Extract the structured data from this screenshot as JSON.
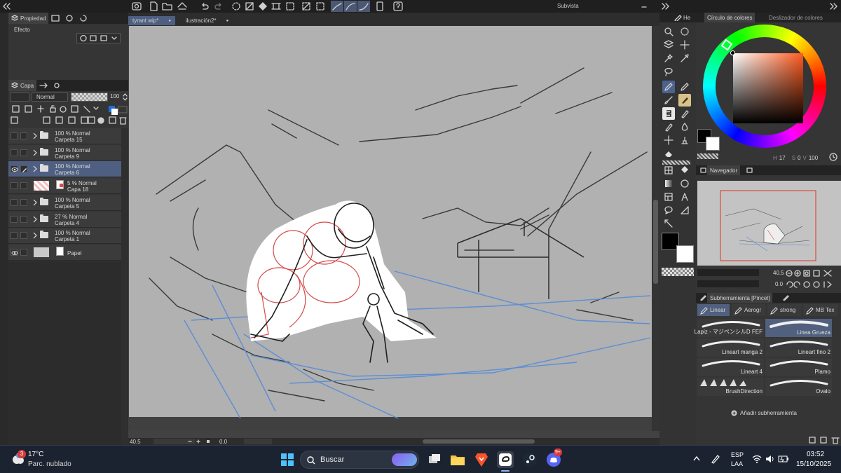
{
  "top_toolbar": {
    "subview_title": "Subvista"
  },
  "left_panel": {
    "properties_tab": "Propiedad",
    "effect_label": "Efecto",
    "layer_tab": "Capa",
    "blend_mode": "Normal",
    "opacity_value": "100",
    "layers": [
      {
        "line1": "100 % Normal",
        "line2": "Carpeta 15",
        "type": "folder",
        "visible": false,
        "selected": false
      },
      {
        "line1": "100 % Normal",
        "line2": "Carpeta 9",
        "type": "folder",
        "visible": false,
        "selected": false
      },
      {
        "line1": "100 % Normal",
        "line2": "Carpeta 6",
        "type": "folder",
        "visible": true,
        "selected": true
      },
      {
        "line1": "5 % Normal",
        "line2": "Capa 18",
        "type": "raster",
        "visible": false,
        "selected": false
      },
      {
        "line1": "100 % Normal",
        "line2": "Carpeta 5",
        "type": "folder",
        "visible": false,
        "selected": false
      },
      {
        "line1": "27 % Normal",
        "line2": "Carpeta 4",
        "type": "folder",
        "visible": false,
        "selected": false
      },
      {
        "line1": "100 % Normal",
        "line2": "Carpeta 1",
        "type": "folder",
        "visible": false,
        "selected": false
      },
      {
        "line1": "",
        "line2": "Papel",
        "type": "paper",
        "visible": true,
        "selected": false
      }
    ]
  },
  "document": {
    "tabs": [
      "tyrant wip*",
      "ilustración2*"
    ],
    "active_tab": 0,
    "zoom_value": "40.5",
    "angle_value": "0.0"
  },
  "color_panel": {
    "tab_color_wheel": "Círculo de colores",
    "tab_slider": "Deslizador de colores",
    "hsv_h": "17",
    "hsv_s": "0",
    "hsv_v": "100",
    "main_color": "#000000",
    "sub_color": "#ffffff"
  },
  "tool_panel": {
    "tab_label": "He"
  },
  "navigator": {
    "title": "Navegador",
    "zoom_value": "40.5",
    "angle_value": "0.0"
  },
  "sub_tool": {
    "title": "Subherramienta [Pincel]",
    "tabs": [
      "Linear",
      "Aerogr",
      "strong",
      "MB Tex"
    ],
    "brushes": [
      "Lapiz - マジペンシルD FEF",
      "Linea Grueza",
      "Lineart manga 2",
      "Lineart fino 2",
      "Lineart 4",
      "Plamo",
      "BrushDirection",
      "Ovalo"
    ],
    "selected_brush": 1,
    "add_label": "Añadir subherramienta"
  },
  "taskbar": {
    "weather_temp": "17°C",
    "weather_desc": "Parc. nublado",
    "weather_badge": "3",
    "search_placeholder": "Buscar",
    "lang_1": "ESP",
    "lang_2": "LAA",
    "time": "03:52",
    "date": "15/10/2025",
    "discord_badge": "9+"
  },
  "colors": {
    "accent": "#4f5f82",
    "canvas": "#b1b1b1",
    "taskbar": "#1c2330"
  }
}
